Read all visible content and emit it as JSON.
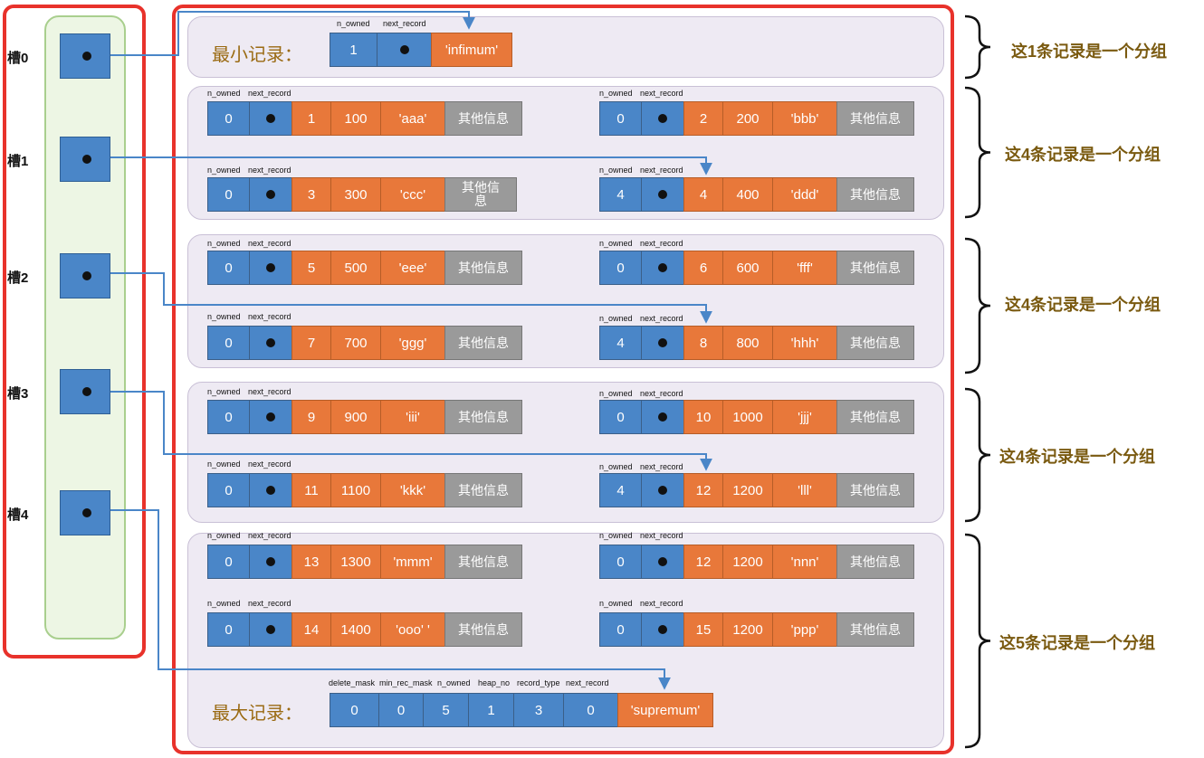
{
  "slots": [
    "槽0",
    "槽1",
    "槽2",
    "槽3",
    "槽4"
  ],
  "headers": {
    "n_owned": "n_owned",
    "next_record": "next_record",
    "delete_mask": "delete_mask",
    "min_rec_mask": "min_rec_mask",
    "heap_no": "heap_no",
    "record_type": "record_type"
  },
  "min_record": {
    "label": "最小记录：",
    "n_owned": "1",
    "value": "'infimum'"
  },
  "max_record": {
    "label": "最大记录：",
    "fields": [
      "0",
      "0",
      "5",
      "1",
      "3",
      "0"
    ],
    "value": "'supremum'"
  },
  "other_info": "其他信息",
  "other_info_wrapped": "其他信\n息",
  "records": [
    {
      "n_owned": "0",
      "pk": "1",
      "col": "100",
      "val": "'aaa'"
    },
    {
      "n_owned": "0",
      "pk": "2",
      "col": "200",
      "val": "'bbb'"
    },
    {
      "n_owned": "0",
      "pk": "3",
      "col": "300",
      "val": "'ccc'"
    },
    {
      "n_owned": "4",
      "pk": "4",
      "col": "400",
      "val": "'ddd'"
    },
    {
      "n_owned": "0",
      "pk": "5",
      "col": "500",
      "val": "'eee'"
    },
    {
      "n_owned": "0",
      "pk": "6",
      "col": "600",
      "val": "'fff'"
    },
    {
      "n_owned": "0",
      "pk": "7",
      "col": "700",
      "val": "'ggg'"
    },
    {
      "n_owned": "4",
      "pk": "8",
      "col": "800",
      "val": "'hhh'"
    },
    {
      "n_owned": "0",
      "pk": "9",
      "col": "900",
      "val": "'iii'"
    },
    {
      "n_owned": "0",
      "pk": "10",
      "col": "1000",
      "val": "'jjj'"
    },
    {
      "n_owned": "0",
      "pk": "11",
      "col": "1100",
      "val": "'kkk'"
    },
    {
      "n_owned": "4",
      "pk": "12",
      "col": "1200",
      "val": "'lll'"
    },
    {
      "n_owned": "0",
      "pk": "13",
      "col": "1300",
      "val": "'mmm'"
    },
    {
      "n_owned": "0",
      "pk": "12",
      "col": "1200",
      "val": "'nnn'"
    },
    {
      "n_owned": "0",
      "pk": "14",
      "col": "1400",
      "val": "'ooo' '"
    },
    {
      "n_owned": "0",
      "pk": "15",
      "col": "1200",
      "val": "'ppp'"
    }
  ],
  "group_labels": [
    "这1条记录是一个分组",
    "这4条记录是一个分组",
    "这4条记录是一个分组",
    "这4条记录是一个分组",
    "这5条记录是一个分组"
  ],
  "colors": {
    "frame": "#e8322b",
    "blue": "#4a86c8",
    "orange": "#e8783a",
    "gray": "#9a9a9a",
    "arrow": "#4a86c8"
  }
}
